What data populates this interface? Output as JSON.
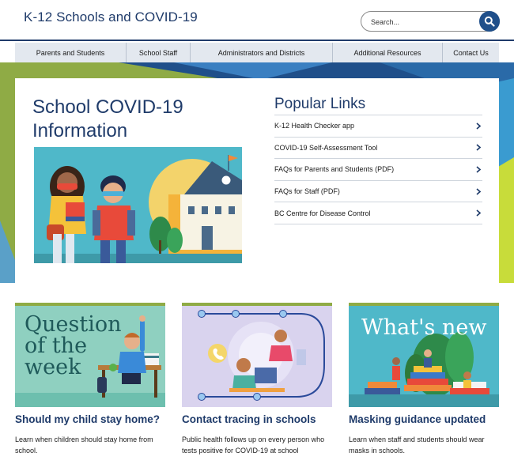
{
  "header": {
    "site_title": "K-12 Schools and COVID-19",
    "search_placeholder": "Search...",
    "accent_color": "#1f3b6a"
  },
  "nav": {
    "items": [
      {
        "label": "Parents and Students"
      },
      {
        "label": "School Staff"
      },
      {
        "label": "Administrators and Districts"
      },
      {
        "label": "Additional Resources"
      },
      {
        "label": "Contact Us"
      }
    ]
  },
  "hero": {
    "title_line1": "School COVID-19",
    "title_line2": "Information",
    "popular_title": "Popular Links",
    "links": [
      {
        "label": "K-12 Health Checker app"
      },
      {
        "label": "COVID-19 Self-Assessment Tool"
      },
      {
        "label": "FAQs for Parents and Students (PDF)"
      },
      {
        "label": "FAQs for Staff (PDF)"
      },
      {
        "label": "BC Centre for Disease Control"
      }
    ]
  },
  "cards": [
    {
      "image_text_line1": "Question",
      "image_text_line2": "of the",
      "image_text_line3": "week",
      "title": "Should my child stay home?",
      "desc": "Learn when children should stay home from school."
    },
    {
      "title": "Contact tracing in schools",
      "desc": "Public health follows up on every person who tests positive for COVID-19 at school"
    },
    {
      "image_text": "What's new",
      "title": "Masking guidance updated",
      "desc": "Learn when staff and students should wear masks in schools."
    }
  ]
}
